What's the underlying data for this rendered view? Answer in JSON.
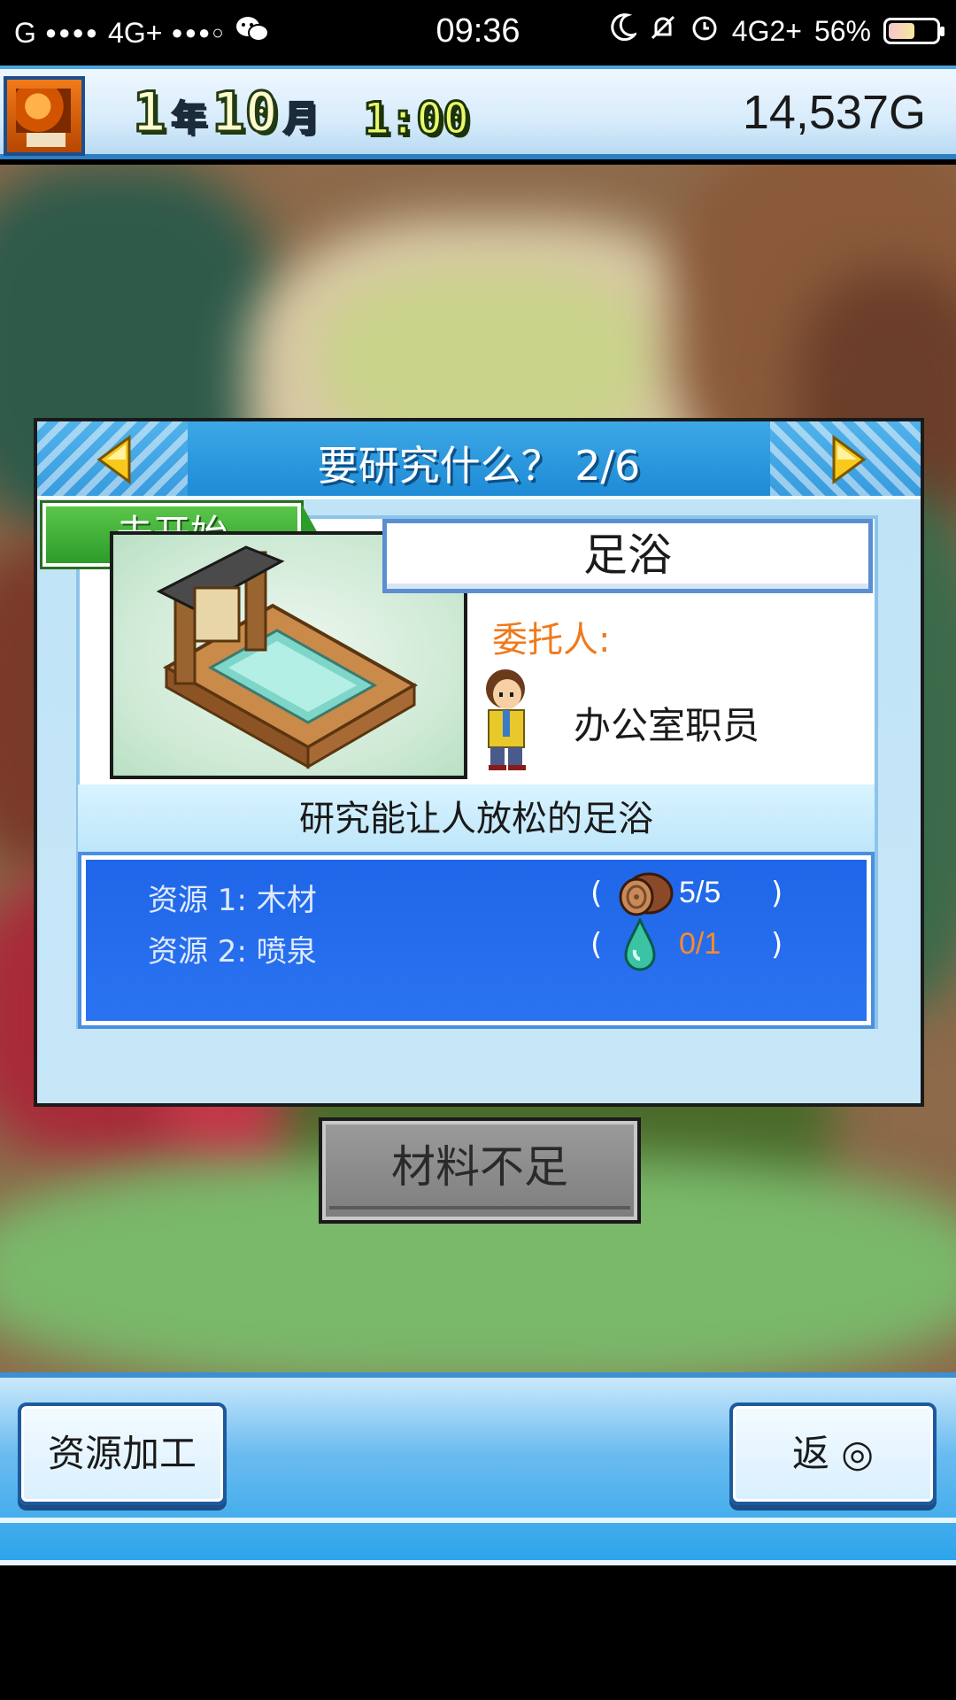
{
  "status_bar": {
    "carrier": "G",
    "network_1": "4G+",
    "time": "09:36",
    "network_2": "4G2+",
    "battery": "56%",
    "battery_level": 0.56
  },
  "top_bar": {
    "year_num": "1",
    "year_unit": "年",
    "month_num": "10",
    "month_unit": "月",
    "clock": "1:00",
    "gold": "14,537G"
  },
  "dialog": {
    "title": "要研究什么？ 2/6",
    "status": "未开始",
    "item_name": "足浴",
    "client_label": "委托人:",
    "client_name": "办公室职员",
    "description": "研究能让人放松的足浴",
    "resources": [
      {
        "label": "资源 1: 木材",
        "open": "(",
        "qty": "5/5",
        "close": ")",
        "icon": "wood-log-icon",
        "sufficient": true
      },
      {
        "label": "资源 2: 喷泉",
        "open": "(",
        "qty": "0/1",
        "close": ")",
        "icon": "water-drop-icon",
        "sufficient": false
      }
    ]
  },
  "insufficient_button": "材料不足",
  "bottom_menu": {
    "left_button": "资源加工",
    "right_button": "返 ◎"
  },
  "colors": {
    "header_blue": "#1d8bd6",
    "resource_blue": "#2a73f0",
    "client_orange": "#ef7a1c",
    "shortage_orange": "#ff8a2a",
    "status_green": "#2c9c2a"
  }
}
